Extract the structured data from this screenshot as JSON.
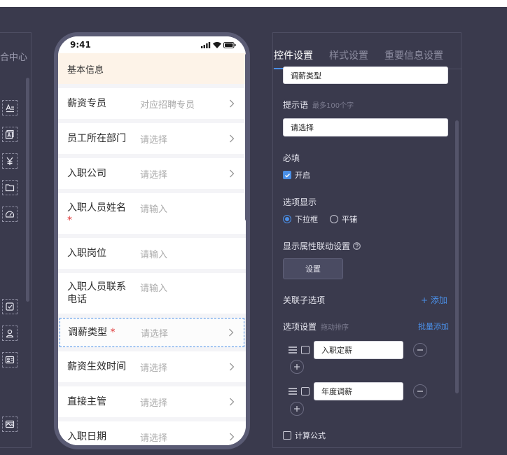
{
  "left_panel": {
    "title": "合中心"
  },
  "phone": {
    "time": "9:41",
    "section_title": "基本信息",
    "rows": [
      {
        "label": "薪资专员",
        "value": "对应招聘专员",
        "chevron": true,
        "required": false
      },
      {
        "label": "员工所在部门",
        "value": "请选择",
        "chevron": true,
        "required": false
      },
      {
        "label": "入职公司",
        "value": "请选择",
        "chevron": true,
        "required": false
      },
      {
        "label": "入职人员姓名",
        "value": "请输入",
        "chevron": false,
        "required": true,
        "req_mark": "*"
      },
      {
        "label": "入职岗位",
        "value": "请输入",
        "chevron": false,
        "required": false
      },
      {
        "label": "入职人员联系电话",
        "value": "请输入",
        "chevron": false,
        "required": false
      },
      {
        "label": "调薪类型",
        "value": "请选择",
        "chevron": true,
        "required": true,
        "req_mark": "*",
        "selected": true
      },
      {
        "label": "薪资生效时间",
        "value": "请选择",
        "chevron": true,
        "required": false
      },
      {
        "label": "直接主管",
        "value": "请选择",
        "chevron": true,
        "required": false
      },
      {
        "label": "入职日期",
        "value": "请选择",
        "chevron": true,
        "required": false
      }
    ]
  },
  "settings": {
    "tabs": [
      "控件设置",
      "样式设置",
      "重要信息设置"
    ],
    "title_field_value": "调薪类型",
    "prompt_label": "提示语",
    "prompt_hint": "最多100个字",
    "prompt_value": "请选择",
    "required_label": "必填",
    "required_option": "开启",
    "display_label": "选项显示",
    "display_options": [
      "下拉框",
      "平铺"
    ],
    "linkage_label": "显示属性联动设置",
    "linkage_button": "设置",
    "sub_options_label": "关联子选项",
    "add_link": "+ 添加",
    "options_label": "选项设置",
    "options_hint": "拖动排序",
    "batch_add": "批量添加",
    "options": [
      "入职定薪",
      "年度调薪"
    ],
    "formula_label": "计算公式"
  },
  "colors": {
    "accent": "#4a8fe7",
    "background": "#3a3a4d",
    "phone_frame": "#5a5b74",
    "section_bg": "#fdf3e8",
    "required": "#e03b3b"
  }
}
